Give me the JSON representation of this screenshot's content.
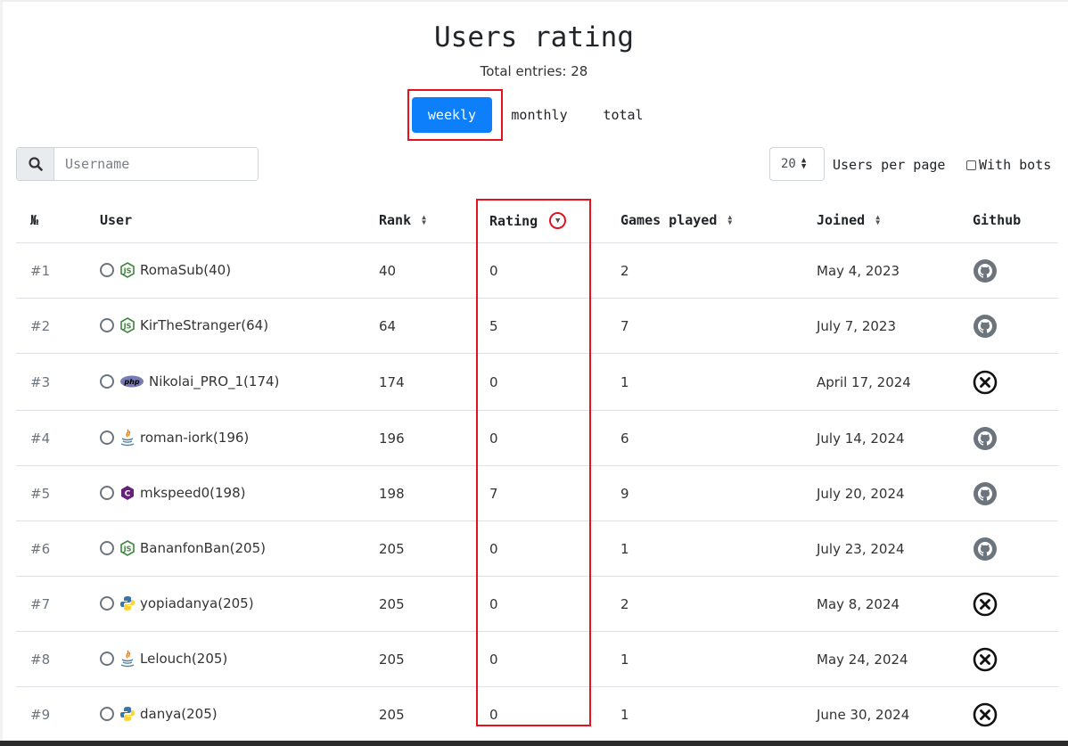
{
  "page": {
    "title": "Users rating",
    "total_entries": "Total entries: 28"
  },
  "tabs": [
    {
      "label": "weekly",
      "active": true
    },
    {
      "label": "monthly",
      "active": false
    },
    {
      "label": "total",
      "active": false
    }
  ],
  "search": {
    "placeholder": "Username"
  },
  "pagination": {
    "per_page_value": "20",
    "per_page_label": "Users per page",
    "with_bots_label": "With bots",
    "with_bots_checked": false
  },
  "columns": {
    "number": "№",
    "user": "User",
    "rank": "Rank",
    "rating": "Rating",
    "games": "Games played",
    "joined": "Joined",
    "github": "Github"
  },
  "colors": {
    "accent": "#0d7ffb",
    "highlight": "#e3121d"
  },
  "rows": [
    {
      "num": "#1",
      "lang_icon": "nodejs-icon",
      "user": "RomaSub(40)",
      "rank": "40",
      "rating": "0",
      "games": "2",
      "joined": "May 4, 2023",
      "github": "github-icon"
    },
    {
      "num": "#2",
      "lang_icon": "nodejs-icon",
      "user": "KirTheStranger(64)",
      "rank": "64",
      "rating": "5",
      "games": "7",
      "joined": "July 7, 2023",
      "github": "github-icon"
    },
    {
      "num": "#3",
      "lang_icon": "php-icon",
      "user": "Nikolai_PRO_1(174)",
      "rank": "174",
      "rating": "0",
      "games": "1",
      "joined": "April 17, 2024",
      "github": "no-github-icon"
    },
    {
      "num": "#4",
      "lang_icon": "java-icon",
      "user": "roman-iork(196)",
      "rank": "196",
      "rating": "0",
      "games": "6",
      "joined": "July 14, 2024",
      "github": "github-icon"
    },
    {
      "num": "#5",
      "lang_icon": "csharp-icon",
      "user": "mkspeed0(198)",
      "rank": "198",
      "rating": "7",
      "games": "9",
      "joined": "July 20, 2024",
      "github": "github-icon"
    },
    {
      "num": "#6",
      "lang_icon": "nodejs-icon",
      "user": "BananfonBan(205)",
      "rank": "205",
      "rating": "0",
      "games": "1",
      "joined": "July 23, 2024",
      "github": "github-icon"
    },
    {
      "num": "#7",
      "lang_icon": "python-icon",
      "user": "yopiadanya(205)",
      "rank": "205",
      "rating": "0",
      "games": "2",
      "joined": "May 8, 2024",
      "github": "no-github-icon"
    },
    {
      "num": "#8",
      "lang_icon": "java-icon",
      "user": "Lelouch(205)",
      "rank": "205",
      "rating": "0",
      "games": "1",
      "joined": "May 24, 2024",
      "github": "no-github-icon"
    },
    {
      "num": "#9",
      "lang_icon": "python-icon",
      "user": "danya(205)",
      "rank": "205",
      "rating": "0",
      "games": "1",
      "joined": "June 30, 2024",
      "github": "no-github-icon"
    }
  ]
}
